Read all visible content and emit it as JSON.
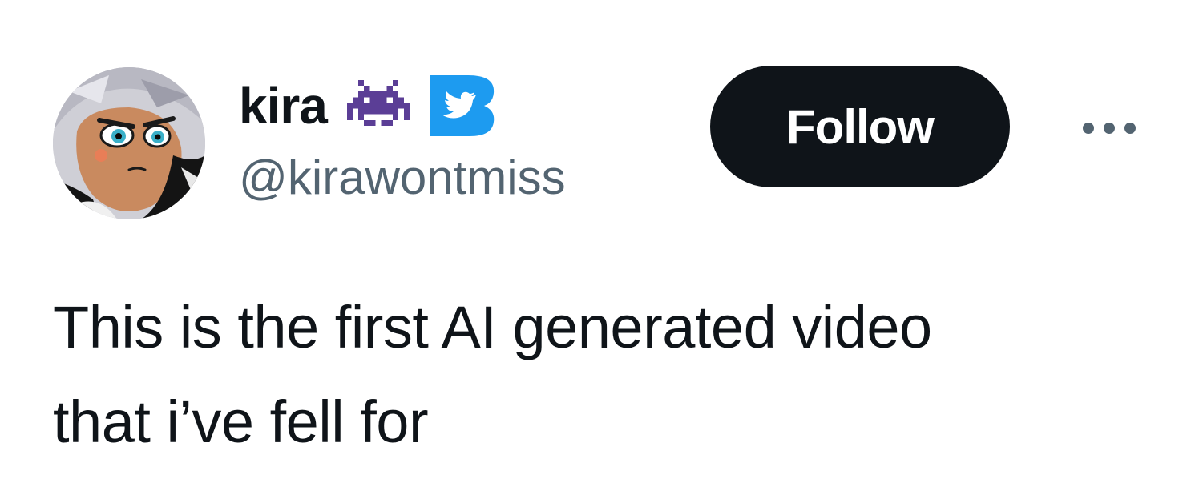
{
  "author": {
    "display_name": "kira",
    "handle": "@kirawontmiss",
    "avatar_icon": "cartoon-avatar",
    "name_emoji_icon": "space-invader-icon",
    "badge_icon": "twitter-b-badge-icon"
  },
  "actions": {
    "follow_label": "Follow",
    "more_icon": "more-dots-icon"
  },
  "tweet": {
    "text_lines": [
      "This is the first AI generated video",
      "that i’ve fell for"
    ]
  },
  "colors": {
    "text_primary": "#0f1419",
    "text_secondary": "#536471",
    "follow_bg": "#0f1419",
    "follow_text": "#ffffff",
    "invader": "#5b3e96",
    "badge": "#1d9bf0",
    "background": "#ffffff"
  }
}
